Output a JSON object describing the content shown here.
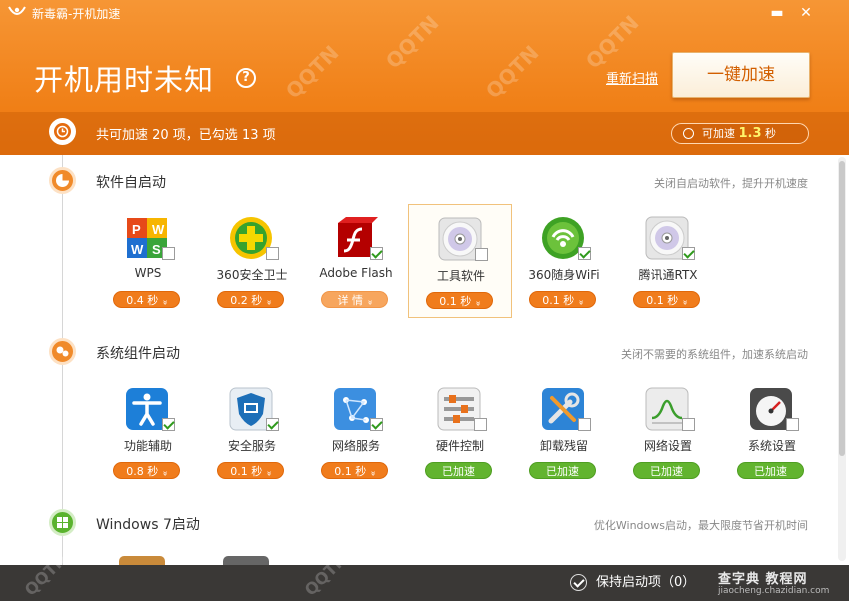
{
  "window": {
    "title": "新毒霸-开机加速",
    "minimize": "▬",
    "close": "✕"
  },
  "header": {
    "headline": "开机用时未知",
    "help": "?",
    "rescan": "重新扫描",
    "boost_button": "一键加速",
    "summary": "共可加速 20 项，已勾选 13 项",
    "speedup_prefix": "可加速",
    "speedup_value": "1.3",
    "speedup_unit": "秒"
  },
  "sections": [
    {
      "title": "软件自启动",
      "hint": "关闭自启动软件，提升开机速度",
      "items": [
        {
          "label": "WPS",
          "badge": "0.4 秒",
          "checked": false,
          "badge_style": "orange",
          "icon": "wps-icon"
        },
        {
          "label": "360安全卫士",
          "badge": "0.2 秒",
          "checked": false,
          "badge_style": "orange",
          "icon": "360-safe-icon"
        },
        {
          "label": "Adobe Flash",
          "badge": "详 情",
          "checked": true,
          "badge_style": "light",
          "icon": "adobe-flash-icon"
        },
        {
          "label": "工具软件",
          "badge": "0.1 秒",
          "checked": false,
          "badge_style": "orange",
          "icon": "disc-icon",
          "selected": true
        },
        {
          "label": "360随身WiFi",
          "badge": "0.1 秒",
          "checked": true,
          "badge_style": "orange",
          "icon": "wifi-icon"
        },
        {
          "label": "腾讯通RTX",
          "badge": "0.1 秒",
          "checked": true,
          "badge_style": "orange",
          "icon": "disc-icon"
        }
      ]
    },
    {
      "title": "系统组件启动",
      "hint": "关闭不需要的系统组件，加速系统启动",
      "items": [
        {
          "label": "功能辅助",
          "badge": "0.8 秒",
          "checked": true,
          "badge_style": "orange",
          "icon": "accessibility-icon"
        },
        {
          "label": "安全服务",
          "badge": "0.1 秒",
          "checked": true,
          "badge_style": "orange",
          "icon": "security-shield-icon"
        },
        {
          "label": "网络服务",
          "badge": "0.1 秒",
          "checked": true,
          "badge_style": "orange",
          "icon": "network-icon"
        },
        {
          "label": "硬件控制",
          "badge": "已加速",
          "checked": false,
          "badge_style": "green",
          "icon": "hardware-sliders-icon"
        },
        {
          "label": "卸载残留",
          "badge": "已加速",
          "checked": false,
          "badge_style": "green",
          "icon": "tools-icon"
        },
        {
          "label": "网络设置",
          "badge": "已加速",
          "checked": false,
          "badge_style": "green",
          "icon": "network-graph-icon"
        },
        {
          "label": "系统设置",
          "badge": "已加速",
          "checked": false,
          "badge_style": "green",
          "icon": "gauge-icon"
        }
      ]
    },
    {
      "title": "Windows 7启动",
      "hint": "优化Windows启动，最大限度节省开机时间",
      "items": []
    }
  ],
  "footer": {
    "keep_label": "保持启动项（0）",
    "watermark": "查字典 教程网",
    "watermark_url": "jiaocheng.chazidian.com"
  },
  "colors": {
    "accent": "#f07f16",
    "green": "#62b42f",
    "dark_bar": "#3a3836"
  }
}
